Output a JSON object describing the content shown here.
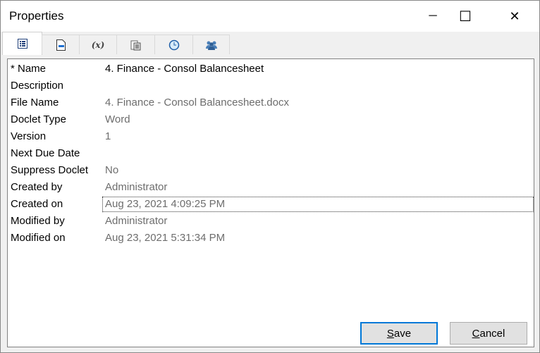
{
  "window": {
    "title": "Properties",
    "minimize": "─",
    "maximize": "☐",
    "close": "✕"
  },
  "tabs": [
    {
      "name": "tab-properties",
      "icon": "list-icon"
    },
    {
      "name": "tab-document",
      "icon": "document-icon"
    },
    {
      "name": "tab-variables",
      "icon": "variable-icon",
      "label": "(x)"
    },
    {
      "name": "tab-clipboard",
      "icon": "clipboard-icon"
    },
    {
      "name": "tab-schedule",
      "icon": "clock-icon"
    },
    {
      "name": "tab-users",
      "icon": "users-icon"
    }
  ],
  "properties": [
    {
      "label": "* Name",
      "value": "4. Finance - Consol Balancesheet"
    },
    {
      "label": "Description",
      "value": ""
    },
    {
      "label": "File Name",
      "value": "4. Finance - Consol Balancesheet.docx"
    },
    {
      "label": "Doclet Type",
      "value": "Word"
    },
    {
      "label": "Version",
      "value": "1"
    },
    {
      "label": "Next Due Date",
      "value": ""
    },
    {
      "label": "Suppress Doclet",
      "value": "No"
    },
    {
      "label": "Created by",
      "value": "Administrator"
    },
    {
      "label": "Created on",
      "value": "Aug 23, 2021 4:09:25 PM"
    },
    {
      "label": "Modified by",
      "value": "Administrator"
    },
    {
      "label": "Modified on",
      "value": "Aug 23, 2021 5:31:34 PM"
    }
  ],
  "buttons": {
    "save_first": "S",
    "save_rest": "ave",
    "cancel_first": "C",
    "cancel_rest": "ancel"
  },
  "colors": {
    "accent": "#0078d7",
    "icon_blue": "#1f5fa8"
  }
}
